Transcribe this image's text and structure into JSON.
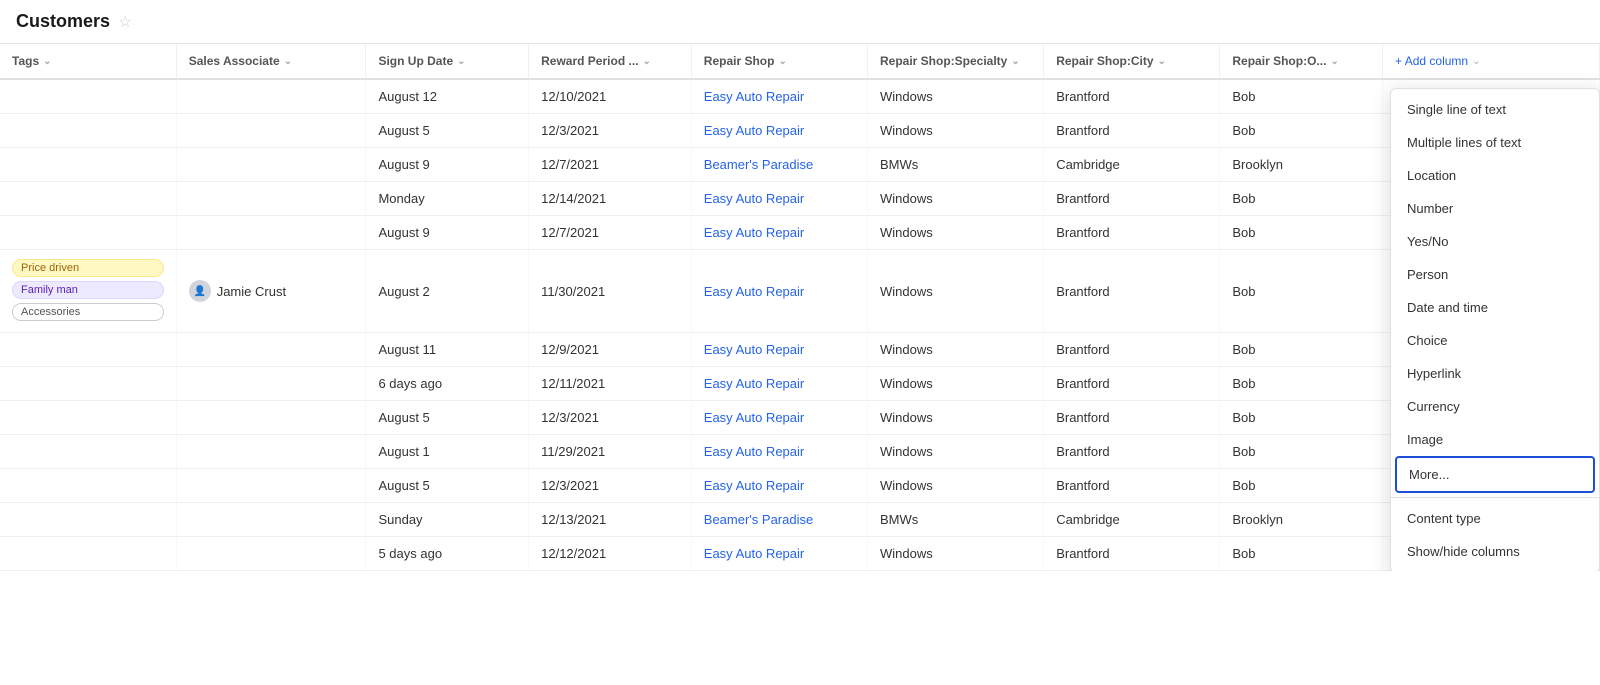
{
  "header": {
    "title": "Customers",
    "star_icon": "★"
  },
  "columns": [
    {
      "id": "tags",
      "label": "Tags",
      "sortable": true
    },
    {
      "id": "sales",
      "label": "Sales Associate",
      "sortable": true
    },
    {
      "id": "signup",
      "label": "Sign Up Date",
      "sortable": true
    },
    {
      "id": "reward",
      "label": "Reward Period ...",
      "sortable": true
    },
    {
      "id": "shop",
      "label": "Repair Shop",
      "sortable": true
    },
    {
      "id": "specialty",
      "label": "Repair Shop:Specialty",
      "sortable": true
    },
    {
      "id": "city",
      "label": "Repair Shop:City",
      "sortable": true
    },
    {
      "id": "owner",
      "label": "Repair Shop:O...",
      "sortable": true
    },
    {
      "id": "add",
      "label": "+ Add column",
      "sortable": true
    }
  ],
  "rows": [
    {
      "tags": "",
      "sales": "",
      "signup": "August 12",
      "reward": "12/10/2021",
      "shop": "Easy Auto Repair",
      "specialty": "Windows",
      "city": "Brantford",
      "owner": "Bob"
    },
    {
      "tags": "",
      "sales": "",
      "signup": "August 5",
      "reward": "12/3/2021",
      "shop": "Easy Auto Repair",
      "specialty": "Windows",
      "city": "Brantford",
      "owner": "Bob"
    },
    {
      "tags": "",
      "sales": "",
      "signup": "August 9",
      "reward": "12/7/2021",
      "shop": "Beamer's Paradise",
      "specialty": "BMWs",
      "city": "Cambridge",
      "owner": "Brooklyn"
    },
    {
      "tags": "",
      "sales": "",
      "signup": "Monday",
      "reward": "12/14/2021",
      "shop": "Easy Auto Repair",
      "specialty": "Windows",
      "city": "Brantford",
      "owner": "Bob"
    },
    {
      "tags": "",
      "sales": "",
      "signup": "August 9",
      "reward": "12/7/2021",
      "shop": "Easy Auto Repair",
      "specialty": "Windows",
      "city": "Brantford",
      "owner": "Bob"
    },
    {
      "tags": "Price driven|Family man|Accessories",
      "sales": "Jamie Crust",
      "signup": "August 2",
      "reward": "11/30/2021",
      "shop": "Easy Auto Repair",
      "specialty": "Windows",
      "city": "Brantford",
      "owner": "Bob"
    },
    {
      "tags": "",
      "sales": "",
      "signup": "August 11",
      "reward": "12/9/2021",
      "shop": "Easy Auto Repair",
      "specialty": "Windows",
      "city": "Brantford",
      "owner": "Bob"
    },
    {
      "tags": "",
      "sales": "",
      "signup": "6 days ago",
      "reward": "12/11/2021",
      "shop": "Easy Auto Repair",
      "specialty": "Windows",
      "city": "Brantford",
      "owner": "Bob"
    },
    {
      "tags": "",
      "sales": "",
      "signup": "August 5",
      "reward": "12/3/2021",
      "shop": "Easy Auto Repair",
      "specialty": "Windows",
      "city": "Brantford",
      "owner": "Bob"
    },
    {
      "tags": "",
      "sales": "",
      "signup": "August 1",
      "reward": "11/29/2021",
      "shop": "Easy Auto Repair",
      "specialty": "Windows",
      "city": "Brantford",
      "owner": "Bob"
    },
    {
      "tags": "",
      "sales": "",
      "signup": "August 5",
      "reward": "12/3/2021",
      "shop": "Easy Auto Repair",
      "specialty": "Windows",
      "city": "Brantford",
      "owner": "Bob"
    },
    {
      "tags": "",
      "sales": "",
      "signup": "Sunday",
      "reward": "12/13/2021",
      "shop": "Beamer's Paradise",
      "specialty": "BMWs",
      "city": "Cambridge",
      "owner": "Brooklyn"
    },
    {
      "tags": "",
      "sales": "",
      "signup": "5 days ago",
      "reward": "12/12/2021",
      "shop": "Easy Auto Repair",
      "specialty": "Windows",
      "city": "Brantford",
      "owner": "Bob"
    }
  ],
  "dropdown": {
    "items": [
      {
        "id": "single-line",
        "label": "Single line of text",
        "highlighted": false
      },
      {
        "id": "multi-line",
        "label": "Multiple lines of text",
        "highlighted": false
      },
      {
        "id": "location",
        "label": "Location",
        "highlighted": false
      },
      {
        "id": "number",
        "label": "Number",
        "highlighted": false
      },
      {
        "id": "yes-no",
        "label": "Yes/No",
        "highlighted": false
      },
      {
        "id": "person",
        "label": "Person",
        "highlighted": false
      },
      {
        "id": "date-time",
        "label": "Date and time",
        "highlighted": false
      },
      {
        "id": "choice",
        "label": "Choice",
        "highlighted": false
      },
      {
        "id": "hyperlink",
        "label": "Hyperlink",
        "highlighted": false
      },
      {
        "id": "currency",
        "label": "Currency",
        "highlighted": false
      },
      {
        "id": "image",
        "label": "Image",
        "highlighted": false
      },
      {
        "id": "more",
        "label": "More...",
        "highlighted": true
      },
      {
        "id": "content-type",
        "label": "Content type",
        "highlighted": false
      },
      {
        "id": "show-hide",
        "label": "Show/hide columns",
        "highlighted": false
      }
    ]
  }
}
